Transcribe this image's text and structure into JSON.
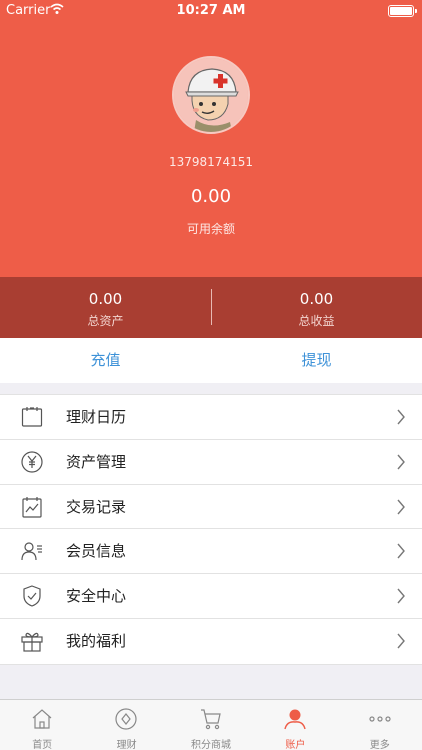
{
  "status_bar": {
    "carrier": "Carrier",
    "time": "10:27 AM"
  },
  "profile": {
    "phone": "13798174151",
    "balance": "0.00",
    "balance_label": "可用余额"
  },
  "stats": [
    {
      "value": "0.00",
      "label": "总资产"
    },
    {
      "value": "0.00",
      "label": "总收益"
    }
  ],
  "actions": {
    "recharge": "充值",
    "withdraw": "提现"
  },
  "menu": [
    {
      "label": "理财日历",
      "icon": "calendar-icon"
    },
    {
      "label": "资产管理",
      "icon": "yen-icon"
    },
    {
      "label": "交易记录",
      "icon": "chart-record-icon"
    },
    {
      "label": "会员信息",
      "icon": "member-icon"
    },
    {
      "label": "安全中心",
      "icon": "shield-icon"
    },
    {
      "label": "我的福利",
      "icon": "gift-icon"
    }
  ],
  "tabs": [
    {
      "label": "首页",
      "icon": "home-icon"
    },
    {
      "label": "理财",
      "icon": "finance-icon"
    },
    {
      "label": "积分商城",
      "icon": "cart-icon"
    },
    {
      "label": "账户",
      "icon": "account-icon",
      "active": true
    },
    {
      "label": "更多",
      "icon": "more-icon"
    }
  ],
  "colors": {
    "hero": "#ee5d48",
    "stats": "#a93e32",
    "link": "#3e92d8"
  }
}
